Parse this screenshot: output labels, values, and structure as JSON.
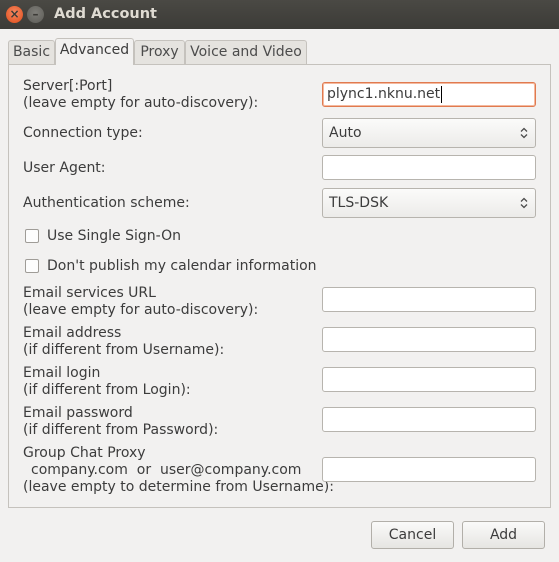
{
  "window": {
    "title": "Add Account",
    "close_glyph": "×",
    "minimize_glyph": "–"
  },
  "tabs": [
    {
      "label": "Basic"
    },
    {
      "label": "Advanced"
    },
    {
      "label": "Proxy"
    },
    {
      "label": "Voice and Video"
    }
  ],
  "active_tab": "Advanced",
  "form": {
    "server": {
      "label1": "Server[:Port]",
      "label2": "(leave empty for auto-discovery):",
      "value": "plync1.nknu.net"
    },
    "connection_type": {
      "label": "Connection type:",
      "value": "Auto"
    },
    "user_agent": {
      "label": "User Agent:",
      "value": ""
    },
    "auth_scheme": {
      "label": "Authentication scheme:",
      "value": "TLS-DSK"
    },
    "single_sign_on": {
      "label": "Use Single Sign-On",
      "checked": false
    },
    "no_publish_calendar": {
      "label": "Don't publish my calendar information",
      "checked": false
    },
    "email_services_url": {
      "label1": "Email services URL",
      "label2": "(leave empty for auto-discovery):",
      "value": ""
    },
    "email_address": {
      "label1": "Email address",
      "label2": "(if different from Username):",
      "value": ""
    },
    "email_login": {
      "label1": "Email login",
      "label2": "(if different from Login):",
      "value": ""
    },
    "email_password": {
      "label1": "Email password",
      "label2": "(if different from Password):",
      "value": ""
    },
    "group_chat_proxy": {
      "label1": "Group Chat Proxy",
      "label2": "company.com  or  user@company.com",
      "label3": "(leave empty to determine from Username):",
      "value": ""
    }
  },
  "buttons": {
    "cancel": "Cancel",
    "add": "Add"
  },
  "colors": {
    "title_bar": "#3c3b37",
    "close_button": "#df4a16",
    "focus_border": "#e07a4f",
    "window_bg": "#f2f1f0"
  }
}
